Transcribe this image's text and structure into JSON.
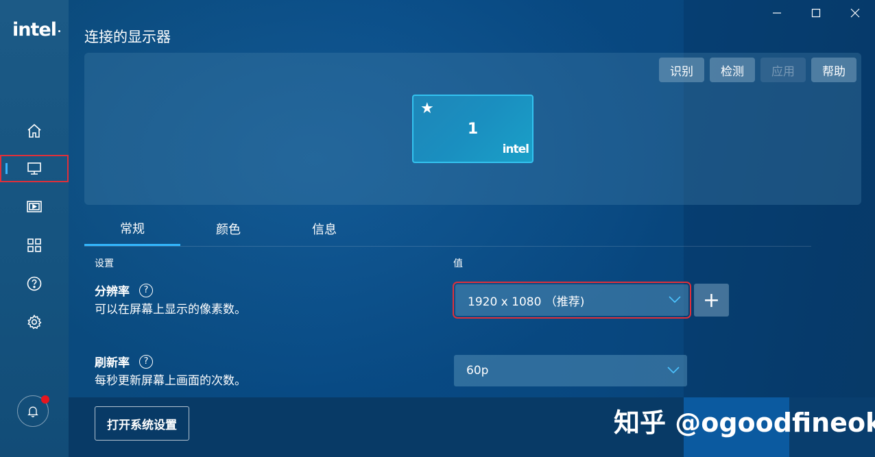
{
  "app": {
    "logo": "intel"
  },
  "window": {
    "minimize_icon": "minimize-icon",
    "maximize_icon": "maximize-icon",
    "close_icon": "close-icon"
  },
  "sidebar": {
    "items": [
      {
        "name": "home",
        "icon": "home-icon"
      },
      {
        "name": "display",
        "icon": "monitor-icon",
        "active": true
      },
      {
        "name": "video",
        "icon": "video-icon"
      },
      {
        "name": "apps",
        "icon": "grid-icon"
      },
      {
        "name": "help",
        "icon": "question-icon"
      },
      {
        "name": "settings",
        "icon": "gear-icon"
      }
    ],
    "notification_icon": "bell-icon"
  },
  "page": {
    "title": "连接的显示器"
  },
  "toolbar": {
    "identify": "识别",
    "detect": "检测",
    "apply": "应用",
    "help": "帮助"
  },
  "monitor": {
    "number": "1",
    "star": "★",
    "brand": "intel"
  },
  "tabs": [
    "常规",
    "颜色",
    "信息"
  ],
  "columns": {
    "setting": "设置",
    "value": "值"
  },
  "settings": {
    "resolution": {
      "name": "分辨率",
      "desc": "可以在屏幕上显示的像素数。",
      "value": "1920 x 1080 （推荐)"
    },
    "refresh": {
      "name": "刷新率",
      "desc": "每秒更新屏幕上画面的次数。",
      "value": "60p"
    }
  },
  "buttons": {
    "open_system_settings": "打开系统设置",
    "add": "+"
  },
  "watermark": "知乎 @ogoodfineok",
  "colors": {
    "accent": "#33b8ff",
    "highlight": "#e0303a",
    "badge": "#e8161e"
  }
}
